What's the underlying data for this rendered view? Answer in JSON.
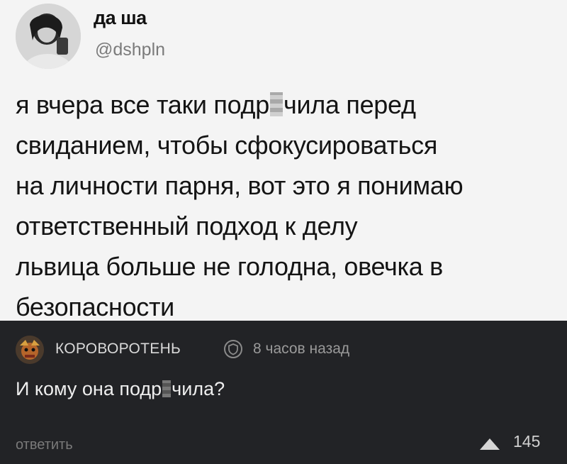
{
  "post": {
    "author_name": "да ша",
    "author_handle": "@dshpln",
    "text_lines": [
      {
        "before": "я вчера все таки подр",
        "after": "чила перед"
      },
      {
        "text": "свиданием, чтобы сфокусироваться"
      },
      {
        "text": "на личности парня, вот это я понимаю"
      },
      {
        "text": "ответственный подход к делу"
      },
      {
        "text": "львица больше не голодна, овечка в"
      },
      {
        "text": "безопасности"
      }
    ]
  },
  "comment": {
    "author": "КОРОВОРОТЕНЬ",
    "time": "8 часов назад",
    "text_before": "И кому она подр",
    "text_after": "чила?",
    "reply_label": "ответить",
    "score": "145"
  },
  "colors": {
    "tweet_bg": "#f4f4f4",
    "comment_bg": "#222326"
  }
}
